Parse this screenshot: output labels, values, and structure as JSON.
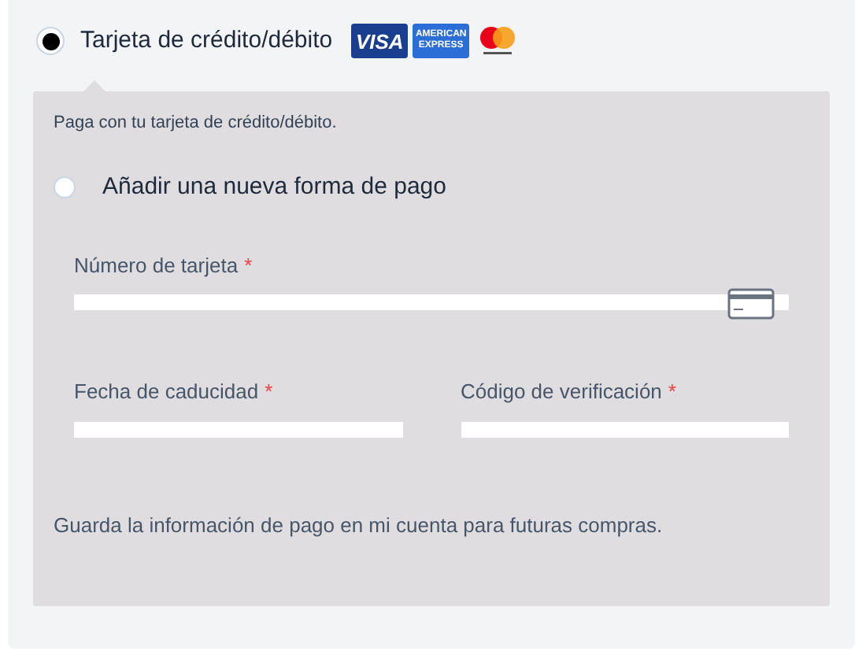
{
  "payment_option": {
    "label": "Tarjeta de crédito/débito",
    "selected": true,
    "brands": [
      {
        "kind": "visa",
        "text": "VISA"
      },
      {
        "kind": "amex",
        "text": "AMERICAN EXPRESS"
      },
      {
        "kind": "mastercard"
      }
    ]
  },
  "panel": {
    "description": "Paga con tu tarjeta de crédito/débito.",
    "new_method": {
      "label": "Añadir una nueva forma de pago",
      "selected": false
    },
    "fields": [
      {
        "label": "Número de tarjeta",
        "required": "*",
        "kind": "card"
      },
      {
        "label": "Fecha de caducidad",
        "required": "*",
        "kind": "half"
      },
      {
        "label": "Código de verificación",
        "required": "*",
        "kind": "half"
      }
    ],
    "save_note": "Guarda la información de pago en mi cuenta para futuras compras."
  }
}
